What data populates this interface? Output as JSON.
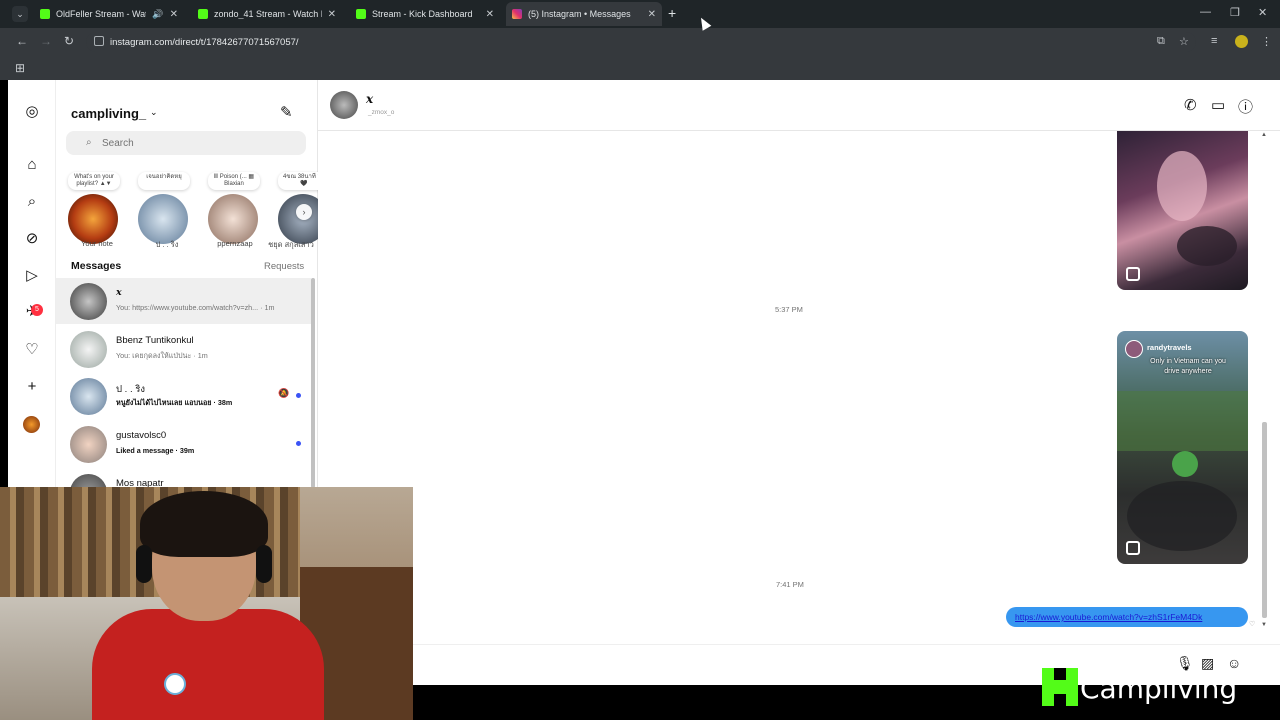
{
  "browser": {
    "tabs": [
      {
        "title": "OldFeller Stream - Watch Li",
        "favicon": "kick-icon"
      },
      {
        "title": "zondo_41 Stream - Watch Live",
        "favicon": "kick-icon"
      },
      {
        "title": "Stream - Kick Dashboard",
        "favicon": "kick-icon"
      },
      {
        "title": "(5) Instagram • Messages",
        "favicon": "instagram-icon",
        "active": true
      }
    ],
    "url": "instagram.com/direct/t/17842677071567057/"
  },
  "rail": {
    "notification_count": "5"
  },
  "inbox": {
    "username": "campliving_",
    "search_placeholder": "Search",
    "notes": [
      {
        "bubble": "What's on your playlist? ▲▼",
        "name": "Your note"
      },
      {
        "bubble": "เจนอย่าคิดหยุ",
        "name": "ป . . ริง"
      },
      {
        "bubble": "Ⅲ Poison (... ▦ Blaxian",
        "name": "ppernzaap"
      },
      {
        "bubble": "4ขณ 38นาที 🖤🖤",
        "name": "ชยุด สกุลเสาว"
      }
    ],
    "messages_label": "Messages",
    "requests_label": "Requests",
    "threads": [
      {
        "name": "x",
        "preview": "You: https://www.youtube.com/watch?v=zh... · 1m",
        "unread": false
      },
      {
        "name": "Bbenz Tuntikonkul",
        "preview": "You: เคยกุดลงให้แป่ปนะ · 1m",
        "unread": false
      },
      {
        "name": "ป . . ริง",
        "preview": "หนูยังไม่ได้ไปไหนเลย แอบนอย · 38m",
        "unread": true,
        "muted": true
      },
      {
        "name": "gustavolsc0",
        "preview": "Liked a message · 39m",
        "unread": true
      },
      {
        "name": "Mos napatr",
        "preview": "",
        "unread": false
      }
    ]
  },
  "chat": {
    "name": "x",
    "handle": "_zmox_o",
    "timestamps": [
      "5:37 PM",
      "7:41 PM"
    ],
    "reel2_creator": "randytravels",
    "reel2_caption": "Only in Vietnam can you drive anywhere",
    "link_message": "https://www.youtube.com/watch?v=zhS1rFeM4Dk"
  },
  "overlay": {
    "watermark": "Campliving"
  },
  "colors": {
    "kick_green": "#53fc18",
    "ig_blue": "#3797f0",
    "badge_red": "#ff3040"
  }
}
